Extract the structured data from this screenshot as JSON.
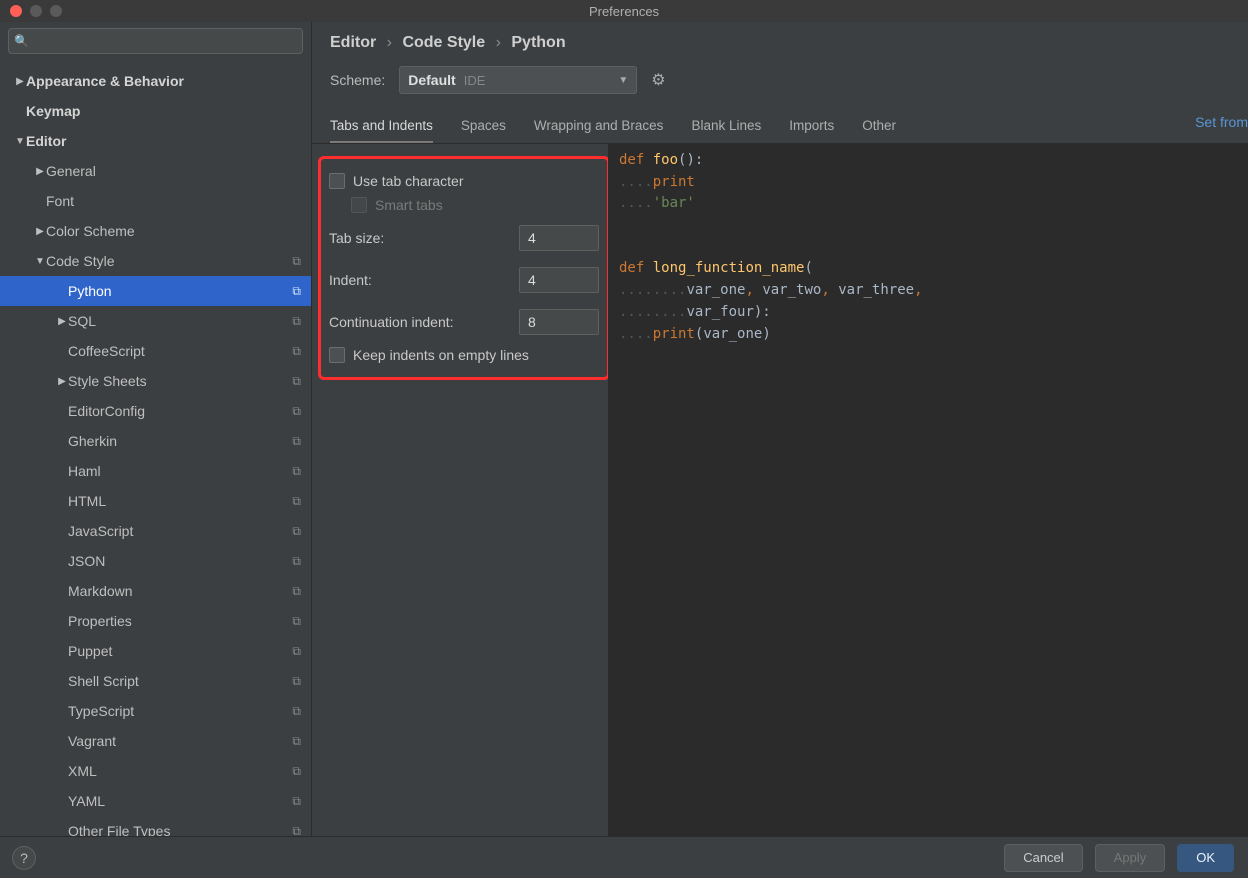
{
  "titlebar": {
    "title": "Preferences"
  },
  "search": {
    "placeholder": ""
  },
  "tree": {
    "appearance": "Appearance & Behavior",
    "keymap": "Keymap",
    "editor": "Editor",
    "general": "General",
    "font": "Font",
    "colorScheme": "Color Scheme",
    "codeStyle": "Code Style",
    "python": "Python",
    "sql": "SQL",
    "coffee": "CoffeeScript",
    "styleSheets": "Style Sheets",
    "editorConfig": "EditorConfig",
    "gherkin": "Gherkin",
    "haml": "Haml",
    "html": "HTML",
    "javascript": "JavaScript",
    "json": "JSON",
    "markdown": "Markdown",
    "properties": "Properties",
    "puppet": "Puppet",
    "shell": "Shell Script",
    "typescript": "TypeScript",
    "vagrant": "Vagrant",
    "xml": "XML",
    "yaml": "YAML",
    "otherFileTypes": "Other File Types"
  },
  "breadcrumbs": {
    "a": "Editor",
    "b": "Code Style",
    "c": "Python"
  },
  "scheme": {
    "label": "Scheme:",
    "value": "Default",
    "tag": "IDE"
  },
  "setFrom": "Set from",
  "tabs": {
    "tabsIndents": "Tabs and Indents",
    "spaces": "Spaces",
    "wrapping": "Wrapping and Braces",
    "blank": "Blank Lines",
    "imports": "Imports",
    "other": "Other"
  },
  "form": {
    "useTab": "Use tab character",
    "smartTabs": "Smart tabs",
    "tabSizeLabel": "Tab size:",
    "tabSizeValue": "4",
    "indentLabel": "Indent:",
    "indentValue": "4",
    "contLabel": "Continuation indent:",
    "contValue": "8",
    "keepIndents": "Keep indents on empty lines"
  },
  "code": {
    "l1_def": "def",
    "l1_foo": " foo",
    "l1_paren": "():",
    "l2_dots": "....",
    "l2_print": "print",
    "l3_dots": "....",
    "l3_bar": "'bar'",
    "blank": "",
    "l5_def": "def",
    "l5_fn": " long_function_name",
    "l5_open": "(",
    "l6_dots": "........",
    "l6_p": "var_one",
    "l6_c1": ",",
    "l6_sp": " ",
    "l6_p2": "var_two",
    "l6_c2": ",",
    "l6_p3": " var_three",
    "l6_c3": ",",
    "l7_dots": "........",
    "l7_p4": "var_four",
    "l7_close": "):",
    "l8_dots": "....",
    "l8_print": "print",
    "l8_open": "(",
    "l8_arg": "var_one",
    "l8_close": ")"
  },
  "footer": {
    "cancel": "Cancel",
    "apply": "Apply",
    "ok": "OK",
    "help": "?"
  }
}
